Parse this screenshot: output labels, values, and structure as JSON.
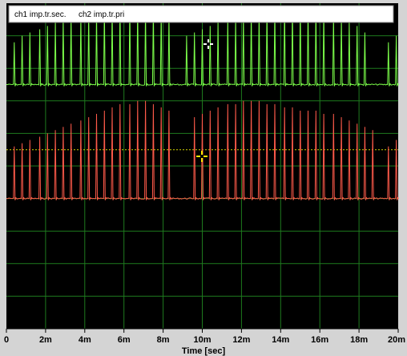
{
  "legend": {
    "ch1_label": "ch1 imp.tr.sec.",
    "ch2_label": "ch2 imp.tr.pri"
  },
  "x_axis": {
    "title": "Time [sec]",
    "ticks": [
      "0",
      "2m",
      "4m",
      "6m",
      "8m",
      "10m",
      "12m",
      "14m",
      "16m",
      "18m",
      "20m"
    ]
  },
  "colors": {
    "background": "#000000",
    "grid": "#1e7a1e",
    "ch1": "#7cff4a",
    "ch2": "#ff5a4a",
    "trigger_level": "#d6d600",
    "cursor_white": "#ffffff",
    "cursor_yellow": "#ffe800"
  },
  "chart_data": {
    "type": "line",
    "title": "",
    "xlabel": "Time [sec]",
    "ylabel": "",
    "xlim": [
      0,
      0.02
    ],
    "grid": true,
    "legend_position": "top-left",
    "series": [
      {
        "name": "ch1 imp.tr.sec.",
        "description_of_shape": "impulse train with burst gap",
        "baseline_div": 2.5,
        "pulse_times": [
          0.0004,
          0.0008,
          0.0012,
          0.0017,
          0.0021,
          0.0025,
          0.0029,
          0.0033,
          0.0038,
          0.0042,
          0.0046,
          0.005,
          0.0054,
          0.0058,
          0.0063,
          0.0067,
          0.0071,
          0.0075,
          0.0079,
          0.0083,
          0.0092,
          0.0096,
          0.01,
          0.0104,
          0.0108,
          0.0113,
          0.0117,
          0.0121,
          0.0125,
          0.0129,
          0.0133,
          0.0137,
          0.0142,
          0.0146,
          0.015,
          0.0154,
          0.0158,
          0.0162,
          0.0167,
          0.0171,
          0.0175,
          0.0179,
          0.0183,
          0.0195,
          0.0199
        ],
        "pulse_heights_div": [
          1.3,
          1.5,
          1.6,
          1.7,
          1.8,
          1.9,
          2.0,
          2.1,
          2.1,
          2.2,
          2.2,
          2.3,
          2.3,
          2.4,
          2.4,
          2.4,
          2.3,
          2.3,
          2.2,
          2.1,
          1.5,
          1.6,
          1.7,
          1.8,
          1.9,
          2.0,
          2.0,
          2.1,
          2.2,
          2.2,
          2.3,
          2.3,
          2.4,
          2.4,
          2.4,
          2.3,
          2.3,
          2.2,
          2.1,
          2.0,
          1.9,
          1.8,
          1.6,
          1.3,
          1.5
        ]
      },
      {
        "name": "ch2 imp.tr.pri",
        "baseline_div": 6.0,
        "pulse_times": [
          0.0004,
          0.0008,
          0.0012,
          0.0017,
          0.0021,
          0.0025,
          0.0029,
          0.0033,
          0.0038,
          0.0042,
          0.0046,
          0.005,
          0.0054,
          0.0058,
          0.0063,
          0.0067,
          0.0071,
          0.0075,
          0.0079,
          0.0083,
          0.0096,
          0.01,
          0.0104,
          0.0108,
          0.0113,
          0.0117,
          0.0121,
          0.0125,
          0.0129,
          0.0133,
          0.0137,
          0.0142,
          0.0146,
          0.015,
          0.0154,
          0.0158,
          0.0162,
          0.0167,
          0.0171,
          0.0175,
          0.0179,
          0.0183,
          0.0187,
          0.0195,
          0.0199
        ],
        "pulse_heights_div": [
          1.6,
          1.7,
          1.8,
          1.9,
          2.0,
          2.1,
          2.2,
          2.3,
          2.4,
          2.5,
          2.6,
          2.7,
          2.8,
          2.9,
          2.9,
          3.0,
          3.0,
          2.9,
          2.8,
          2.7,
          2.5,
          2.6,
          2.7,
          2.8,
          2.9,
          2.9,
          3.0,
          3.0,
          3.0,
          2.9,
          2.9,
          2.8,
          2.8,
          2.7,
          2.7,
          2.7,
          2.6,
          2.6,
          2.5,
          2.4,
          2.3,
          2.2,
          2.1,
          1.6,
          1.8
        ]
      }
    ],
    "trigger_level_div": 4.5
  }
}
